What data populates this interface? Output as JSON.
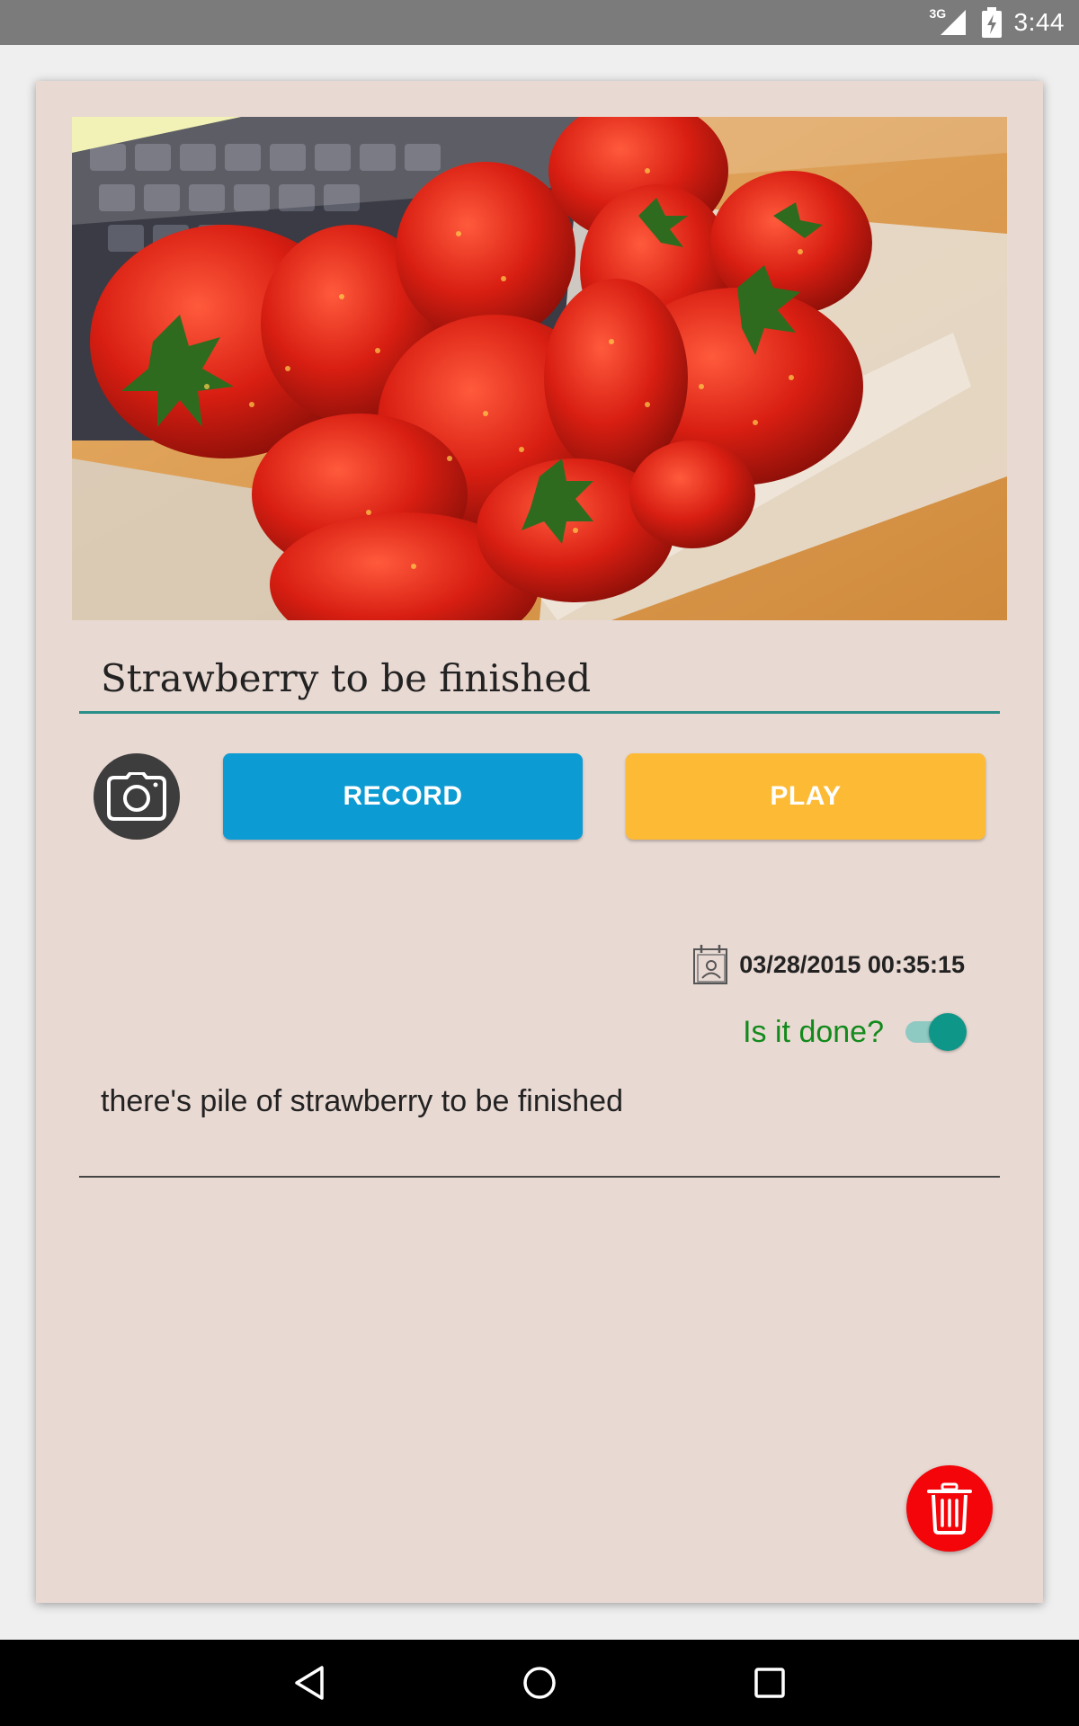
{
  "status_bar": {
    "network": "3G",
    "time": "3:44"
  },
  "note": {
    "title": "Strawberry to be finished",
    "date": "03/28/2015 00:35:15",
    "done_label": "Is it done?",
    "done": true,
    "description": "there's pile of strawberry to be finished"
  },
  "actions": {
    "record_label": "RECORD",
    "play_label": "PLAY"
  },
  "icons": {
    "camera": "camera-icon",
    "calendar": "calendar-icon",
    "delete": "trash-icon",
    "back": "back-icon",
    "home": "home-icon",
    "recents": "recents-icon"
  },
  "colors": {
    "card_background": "#e9d9d3",
    "record_button": "#0c9bd2",
    "play_button": "#fdba35",
    "accent": "#0e9688",
    "done_label": "#138a1c",
    "delete_button": "#f3050a"
  }
}
